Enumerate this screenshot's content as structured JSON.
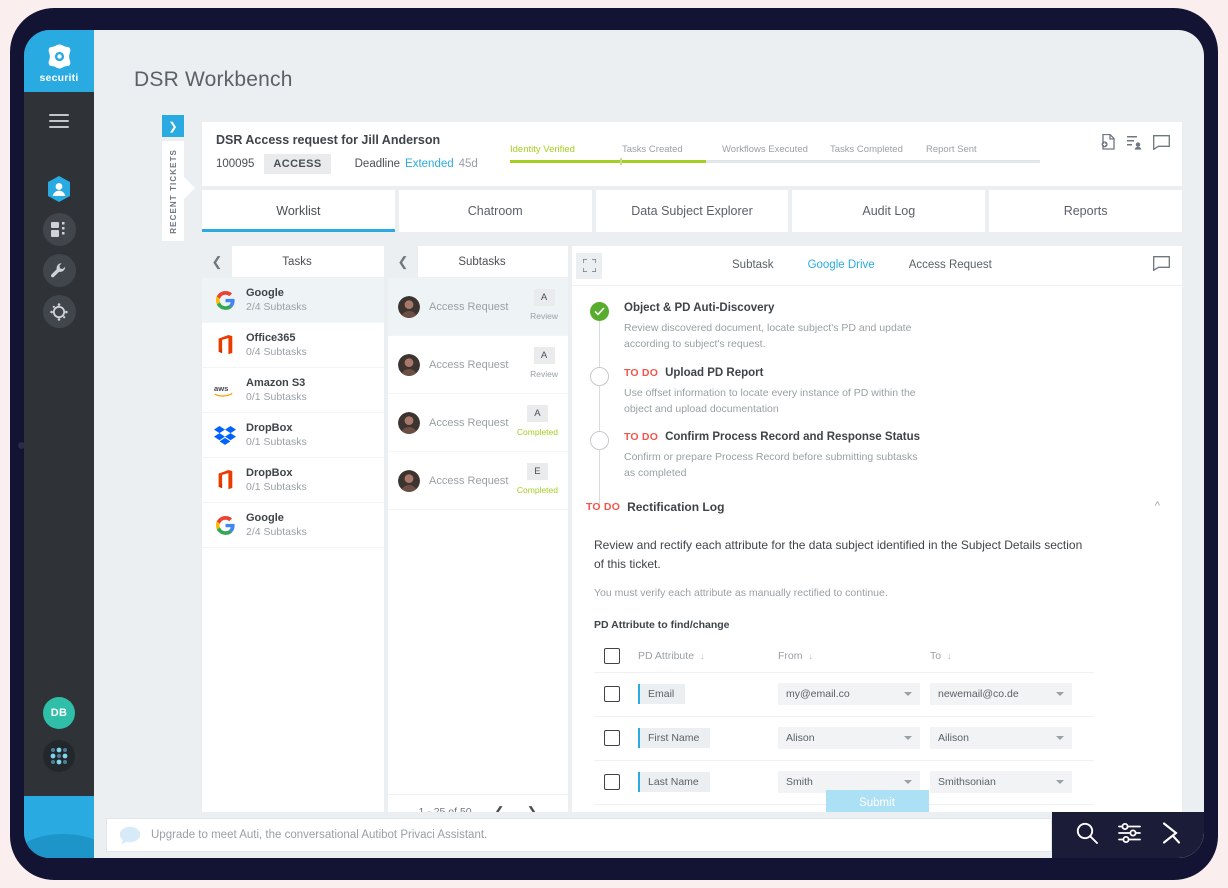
{
  "brand": {
    "name": "securiti",
    "logo_icon": "securiti-logo-icon",
    "accent": "#29abe2",
    "rail_bg": "#2f3338"
  },
  "page": {
    "title": "DSR Workbench"
  },
  "rail": {
    "menu_icon": "hamburger-menu-icon",
    "nav": [
      {
        "icon": "privaci-hex-icon",
        "name": "sidebar-item-privaci",
        "active": true
      },
      {
        "icon": "dashboard-icon",
        "name": "sidebar-item-dashboard",
        "active": false
      },
      {
        "icon": "wrench-icon",
        "name": "sidebar-item-tools",
        "active": false
      },
      {
        "icon": "settings-gear-icon",
        "name": "sidebar-item-settings",
        "active": false
      }
    ],
    "avatar_initials": "DB",
    "apps_icon": "apps-grid-icon"
  },
  "recent_tickets": {
    "label": "RECENT TICKETS",
    "toggle_icon": "chevron-right-icon"
  },
  "ticket": {
    "title": "DSR Access request for Jill Anderson",
    "id": "100095",
    "type": "ACCESS",
    "deadline_label": "Deadline",
    "deadline_link": "Extended",
    "deadline_days": "45d",
    "icons": [
      {
        "name": "add-document-icon"
      },
      {
        "name": "assign-user-icon"
      },
      {
        "name": "comment-icon"
      }
    ],
    "progress": {
      "fill_percent": 37,
      "steps": [
        {
          "label": "Identity Verified",
          "state": "done"
        },
        {
          "label": "Tasks Created",
          "state": "todo"
        },
        {
          "label": "Workflows Executed",
          "state": "todo"
        },
        {
          "label": "Tasks Completed",
          "state": "todo"
        },
        {
          "label": "Report Sent",
          "state": "todo"
        }
      ]
    }
  },
  "tabs": [
    {
      "label": "Worklist",
      "active": true
    },
    {
      "label": "Chatroom",
      "active": false
    },
    {
      "label": "Data Subject Explorer",
      "active": false
    },
    {
      "label": "Audit Log",
      "active": false
    },
    {
      "label": "Reports",
      "active": false
    }
  ],
  "tasks_panel": {
    "header": "Tasks",
    "back_icon": "chevron-left-icon",
    "items": [
      {
        "name": "Google",
        "subtasks": "2/4 Subtasks",
        "icon": "google-icon",
        "selected": true
      },
      {
        "name": "Office365",
        "subtasks": "0/4 Subtasks",
        "icon": "office365-icon",
        "selected": false
      },
      {
        "name": "Amazon S3",
        "subtasks": "0/1 Subtasks",
        "icon": "aws-icon",
        "selected": false
      },
      {
        "name": "DropBox",
        "subtasks": "0/1 Subtasks",
        "icon": "dropbox-icon",
        "selected": false
      },
      {
        "name": "DropBox",
        "subtasks": "0/1 Subtasks",
        "icon": "office365-icon",
        "selected": false
      },
      {
        "name": "Google",
        "subtasks": "2/4 Subtasks",
        "icon": "google-icon",
        "selected": false
      }
    ]
  },
  "subtasks_panel": {
    "header": "Subtasks",
    "back_icon": "chevron-left-icon",
    "items": [
      {
        "name": "Access Request",
        "badge": "A",
        "status": "Review",
        "status_kind": "review",
        "selected": true
      },
      {
        "name": "Access Request",
        "badge": "A",
        "status": "Review",
        "status_kind": "review",
        "selected": false
      },
      {
        "name": "Access Request",
        "badge": "A",
        "status": "Completed",
        "status_kind": "completed",
        "selected": false
      },
      {
        "name": "Access Request",
        "badge": "E",
        "status": "Completed",
        "status_kind": "completed",
        "selected": false
      }
    ],
    "pagination": {
      "range": "1 - 25 of 50",
      "prev_icon": "chevron-left-icon",
      "next_icon": "chevron-right-icon"
    }
  },
  "detail": {
    "expand_icon": "expand-fullscreen-icon",
    "comment_icon": "comment-icon",
    "breadcrumb": [
      {
        "label": "Subtask",
        "link": false
      },
      {
        "label": "Google Drive",
        "link": true
      },
      {
        "label": "Access Request",
        "link": false
      }
    ],
    "checklist": [
      {
        "state": "done",
        "tag": "",
        "title": "Object & PD Auti-Discovery",
        "desc": "Review discovered document, locate subject's PD and update according to subject's request."
      },
      {
        "state": "todo",
        "tag": "TO DO",
        "title": "Upload PD Report",
        "desc": "Use offset information to locate every instance of PD within the object and upload documentation"
      },
      {
        "state": "todo",
        "tag": "TO DO",
        "title": "Confirm Process Record and Response Status",
        "desc": "Confirm or prepare Process Record before submitting subtasks as completed"
      }
    ],
    "rectification": {
      "tag": "TO DO",
      "title": "Rectification Log",
      "collapse_icon": "chevron-up-icon",
      "lead": "Review and rectify each attribute for the data subject identified in the Subject Details section of this ticket.",
      "note": "You must verify each attribute as manually rectified to continue.",
      "subheading": "PD Attribute to find/change",
      "table": {
        "columns": [
          "PD Attribute",
          "From",
          "To"
        ],
        "sort_icon": "sort-down-arrow-icon",
        "rows": [
          {
            "attribute": "Email",
            "from": "my@email.co",
            "to": "newemail@co.de"
          },
          {
            "attribute": "First Name",
            "from": "Alison",
            "to": "Ailison"
          },
          {
            "attribute": "Last Name",
            "from": "Smith",
            "to": "Smithsonian"
          }
        ]
      },
      "submit_label": "Submit"
    }
  },
  "chat": {
    "bubble_icon": "chat-bubble-icon",
    "placeholder": "Upgrade to meet Auti, the conversational Autibot Privaci Assistant.",
    "actions": [
      {
        "name": "search-icon"
      },
      {
        "name": "filter-sliders-icon"
      },
      {
        "name": "send-arrow-icon"
      }
    ]
  }
}
